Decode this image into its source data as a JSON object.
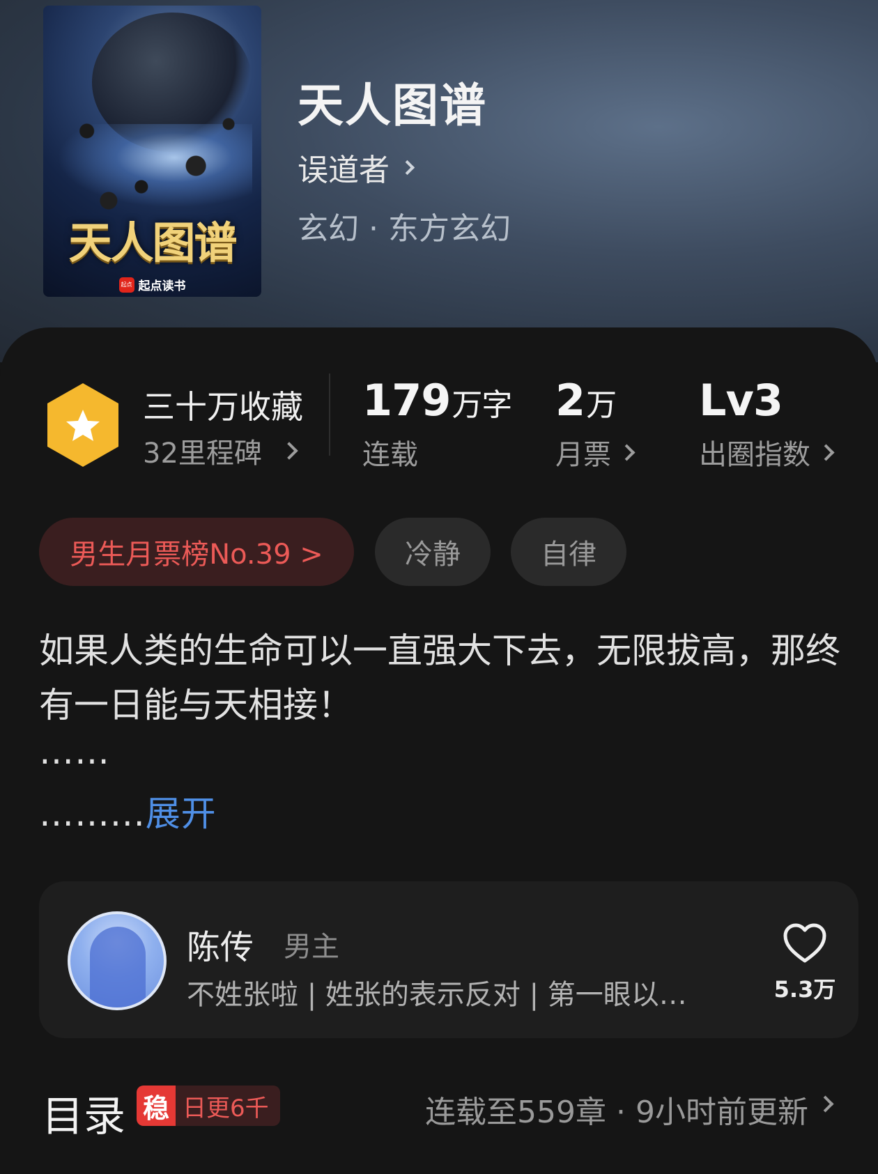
{
  "book": {
    "title": "天人图谱",
    "author": "误道者",
    "genre": "玄幻 · 东方玄幻",
    "cover": {
      "title_art": "天人图谱",
      "brand": "起点读书",
      "brand_icon_text": "起点"
    }
  },
  "stats": {
    "collection_title": "三十万收藏",
    "collection_sub": "32里程碑",
    "word_count_number": "179",
    "word_count_unit": "万字",
    "word_count_label": "连载",
    "monthly_votes_number": "2",
    "monthly_votes_unit": "万",
    "monthly_votes_label": "月票",
    "level_value": "Lv3",
    "level_label": "出圈指数"
  },
  "tags": {
    "rank": "男生月票榜No.39 >",
    "tag1": "冷静",
    "tag2": "自律"
  },
  "description": {
    "text": "如果人类的生命可以一直强大下去，无限拔高，那终有一日能与天相接！",
    "line2": "……",
    "line3": "……...",
    "expand": "展开"
  },
  "character": {
    "name": "陈传",
    "role": "男主",
    "desc": "不姓张啦 | 姓张的表示反对 | 第一眼以…",
    "likes": "5.3万",
    "icon": "heart-icon"
  },
  "toc": {
    "title": "目录",
    "badge_icon": "稳",
    "badge_text": "日更6千",
    "status": "连载至559章 · 9小时前更新"
  },
  "colors": {
    "accent_red": "#ec5a57",
    "link_blue": "#4f8fe6",
    "badge_gold": "#f5b82e",
    "background": "#151515"
  }
}
